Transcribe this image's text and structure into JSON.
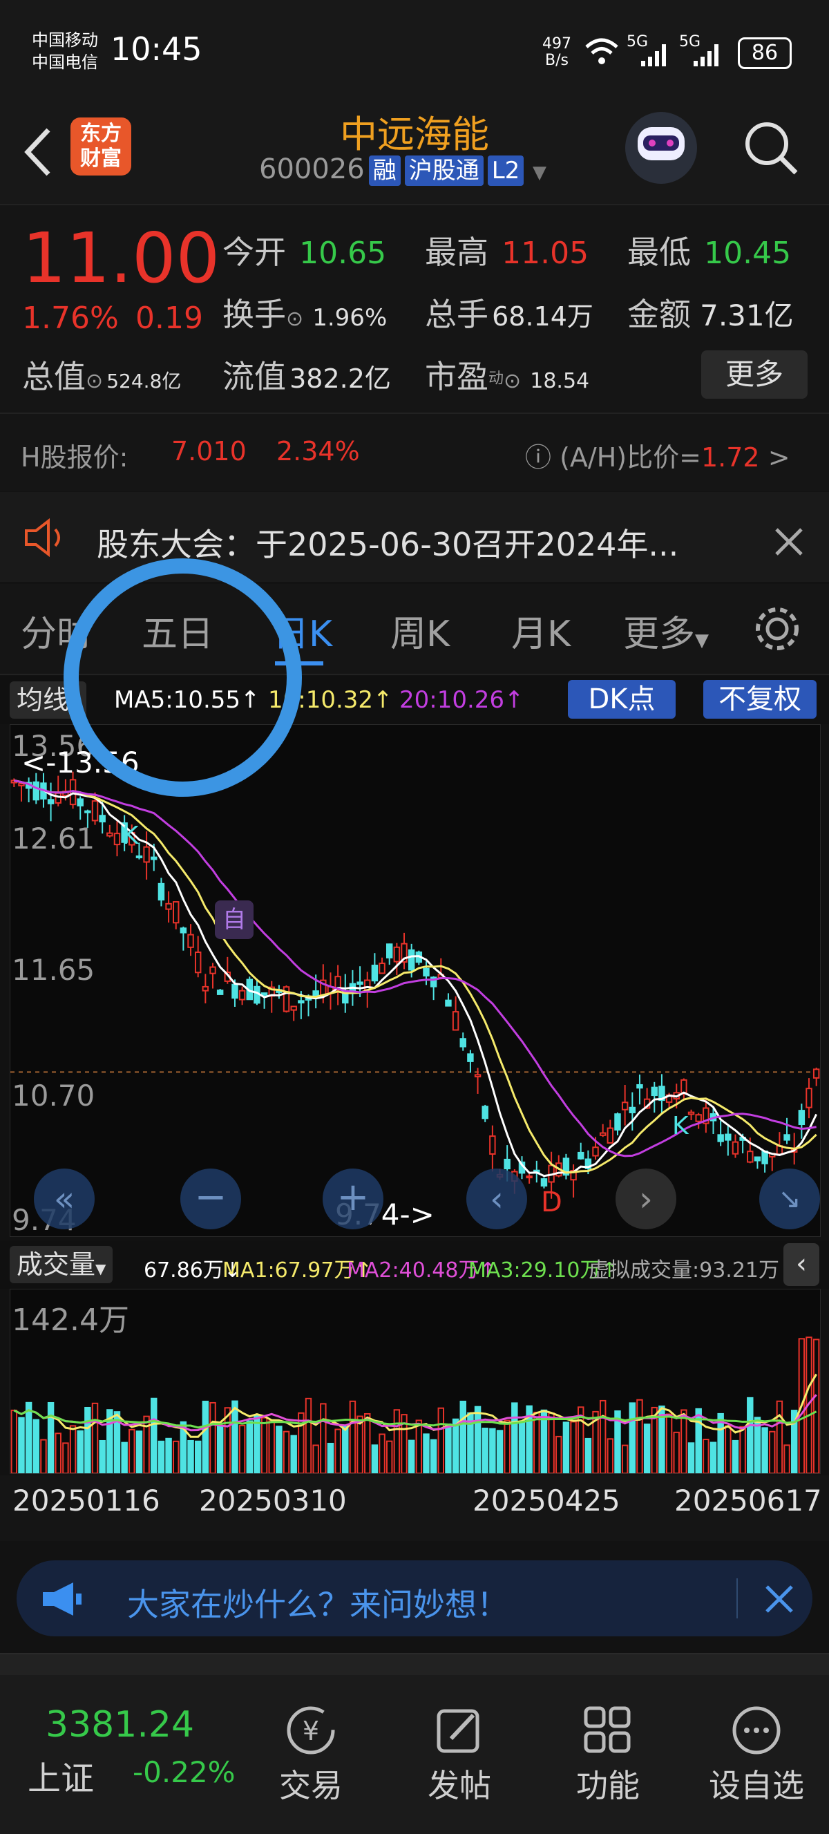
{
  "status_bar": {
    "carrier1": "中国移动",
    "carrier2": "中国电信",
    "time": "10:45",
    "net_speed_top": "497",
    "net_speed_unit": "B/s",
    "sig1": "5G",
    "sig2": "5G",
    "battery": "86"
  },
  "header": {
    "logo_text_1": "东方",
    "logo_text_2": "财富",
    "stock_name": "中远海能",
    "stock_code": "600026",
    "tags": [
      "融",
      "沪股通",
      "L2"
    ]
  },
  "quote": {
    "price": "11.00",
    "change_pct": "1.76%",
    "change_amt": "0.19",
    "open_label": "今开",
    "open": "10.65",
    "high_label": "最高",
    "high": "11.05",
    "low_label": "最低",
    "low": "10.45",
    "turnover_label": "换手",
    "turnover": "1.96%",
    "volume_label": "总手",
    "volume": "68.14万",
    "amount_label": "金额",
    "amount": "7.31亿",
    "mktcap_label": "总值",
    "mktcap": "524.8亿",
    "float_label": "流值",
    "float_cap": "382.2亿",
    "pe_label": "市盈",
    "pe_sup": "动",
    "pe": "18.54",
    "more_button": "更多"
  },
  "h_share": {
    "label": "H股报价:",
    "price": "7.010",
    "change": "2.34%",
    "ratio_label": "(A/H)比价=",
    "ratio": "1.72",
    "arrow": ">"
  },
  "notice": {
    "text": "股东大会：于2025-06-30召开2024年..."
  },
  "tabs": [
    "分时",
    "五日",
    "日K",
    "周K",
    "月K",
    "更多"
  ],
  "chart": {
    "ma_select": "均线",
    "ma5": "MA5:10.55↑",
    "ma10": "10:10.32↑",
    "ma20": "20:10.26↑",
    "dk_button": "DK点",
    "fq_button": "不复权",
    "y_labels": [
      "13.56",
      "12.61",
      "11.65",
      "10.70",
      "9.74"
    ],
    "max_label": "<-13.56",
    "min_label": "9.74->",
    "marker_self": "自",
    "marker_k1": "K",
    "marker_k2": "K",
    "marker_d": "D",
    "colors": {
      "up": "#e8332a",
      "down": "#4fe3e3",
      "ma5": "#ffffff",
      "ma10": "#f5ea6b",
      "ma20": "#c23ee0"
    }
  },
  "volume": {
    "select": "成交量",
    "vol": "67.86万↓",
    "ma1": "MA1:67.97万↑",
    "ma2": "MA2:40.48万↑",
    "ma3": "MA3:29.10万↑",
    "virtual": "虚拟成交量:93.21万",
    "max_label": "142.4万"
  },
  "dates": [
    "20250116",
    "20250310",
    "20250425",
    "20250617"
  ],
  "ask": {
    "text": "大家在炒什么？来问妙想！"
  },
  "bottom": {
    "index_value": "3381.24",
    "index_name": "上证",
    "index_change": "-0.22%",
    "nav": [
      "交易",
      "发帖",
      "功能",
      "设自选"
    ]
  }
}
